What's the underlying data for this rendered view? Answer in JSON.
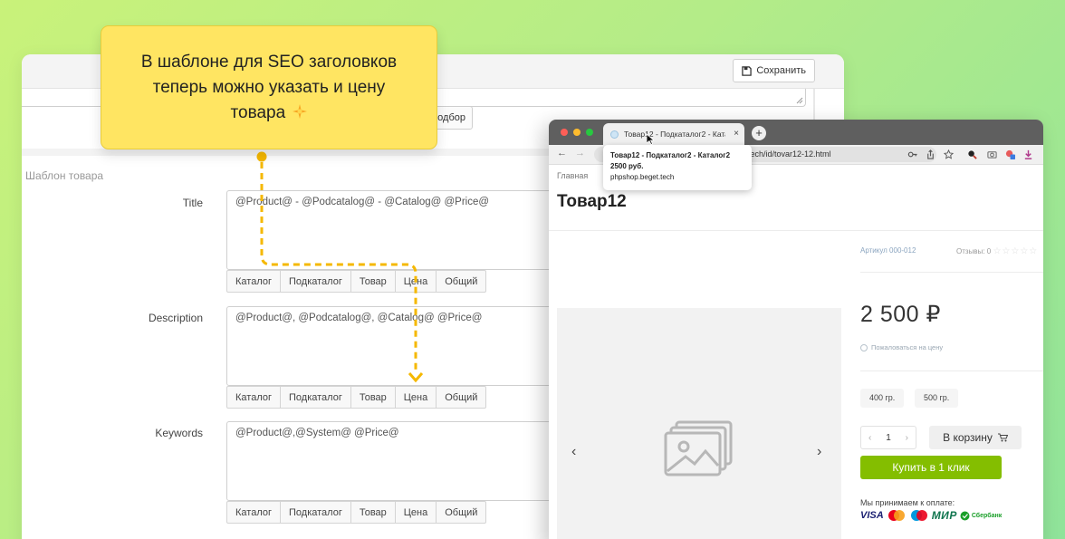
{
  "admin": {
    "save_label": "Сохранить",
    "select_label": "одбор",
    "section_title": "Шаблон товара",
    "fields": [
      {
        "label": "Title",
        "value": "@Product@ - @Podcatalog@ - @Catalog@ @Price@"
      },
      {
        "label": "Description",
        "value": "@Product@, @Podcatalog@, @Catalog@ @Price@"
      },
      {
        "label": "Keywords",
        "value": "@Product@,@System@ @Price@"
      }
    ],
    "tags": [
      "Каталог",
      "Подкаталог",
      "Товар",
      "Цена",
      "Общий"
    ]
  },
  "callout": {
    "text": "В шаблоне для SEO заголовков теперь можно указать и цену товара"
  },
  "browser": {
    "tab_title": "Товар12 - Подкаталог2 - Каталог2 2500 руб.",
    "tab_close": "×",
    "new_tab": "+",
    "address": "et.tech/id/tovar12-12.html",
    "tooltip_title": "Товар12 - Подкаталог2 - Каталог2 2500 руб.",
    "tooltip_domain": "phpshop.beget.tech",
    "icons": [
      "key-icon",
      "share-icon",
      "star-icon",
      "extension-icon",
      "camera-icon",
      "extension-badge-icon",
      "download-icon"
    ]
  },
  "shop": {
    "breadcrumb": "Главная",
    "product_title": "Товар12",
    "sku": "Артикул 000-012",
    "reviews": "Отзывы: 0",
    "stars": "☆☆☆☆☆",
    "price": "2 500 ₽",
    "complain": "Пожаловаться на цену",
    "weights": [
      "400 гр.",
      "500 гр."
    ],
    "qty": "1",
    "qty_minus": "‹",
    "qty_plus": "›",
    "cart_label": "В корзину",
    "buy_label": "Купить в 1 клик",
    "pay_label": "Мы принимаем к оплате:",
    "pay_visa": "VISA",
    "pay_mir": "МИР",
    "pay_sber": "Сбербанк",
    "gallery_prev": "‹",
    "gallery_next": "›"
  },
  "colors": {
    "accent_green": "#84be00",
    "callout_yellow": "#ffe562",
    "dash_orange": "#f5b800"
  }
}
